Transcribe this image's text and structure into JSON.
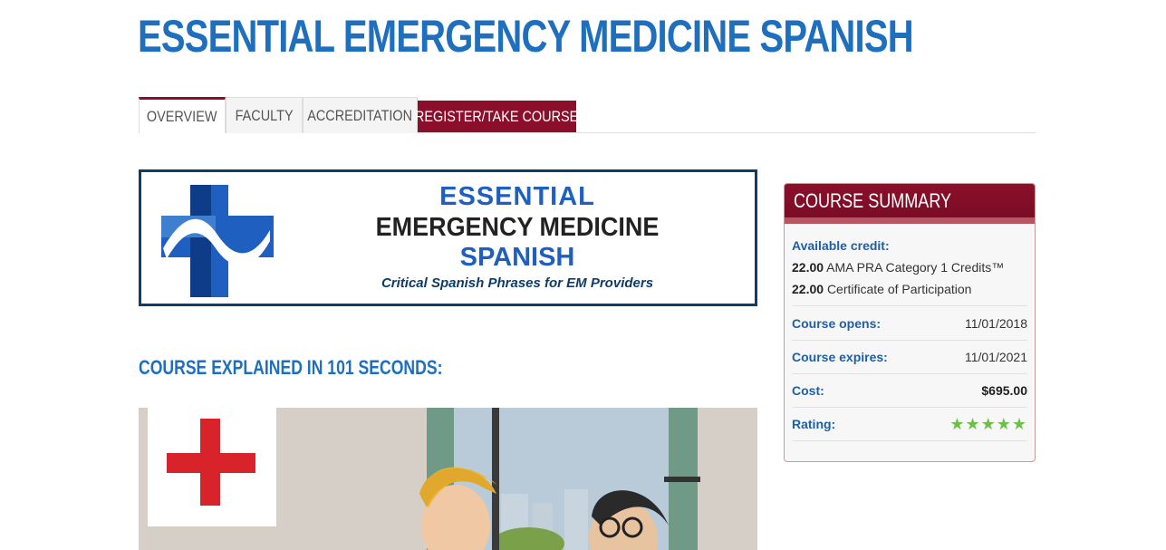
{
  "page": {
    "title": "ESSENTIAL EMERGENCY MEDICINE SPANISH"
  },
  "tabs": [
    {
      "label": "OVERVIEW"
    },
    {
      "label": "FACULTY"
    },
    {
      "label": "ACCREDITATION"
    },
    {
      "label": "REGISTER/TAKE COURSE"
    }
  ],
  "banner": {
    "line1": "ESSENTIAL",
    "line2": "EMERGENCY MEDICINE",
    "line3": "SPANISH",
    "tagline": "Critical Spanish Phrases for EM Providers",
    "logo_icon": "medical-cross-wave-icon"
  },
  "section": {
    "heading": "COURSE EXPLAINED IN 101 SECONDS:"
  },
  "summary": {
    "title": "COURSE SUMMARY",
    "available_label": "Available credit:",
    "credits": [
      {
        "amount": "22.00",
        "text": "AMA PRA Category 1 Credits™"
      },
      {
        "amount": "22.00",
        "text": "Certificate of Participation"
      }
    ],
    "opens_label": "Course opens:",
    "opens_value": "11/01/2018",
    "expires_label": "Course expires:",
    "expires_value": "11/01/2021",
    "cost_label": "Cost:",
    "cost_value": "$695.00",
    "rating_label": "Rating:",
    "rating": {
      "stars": 5,
      "max": 5,
      "display": "★★★★★"
    }
  },
  "colors": {
    "brand_blue": "#1f6fbf",
    "brand_red": "#8b0f2b",
    "star_green": "#6cc04a"
  }
}
